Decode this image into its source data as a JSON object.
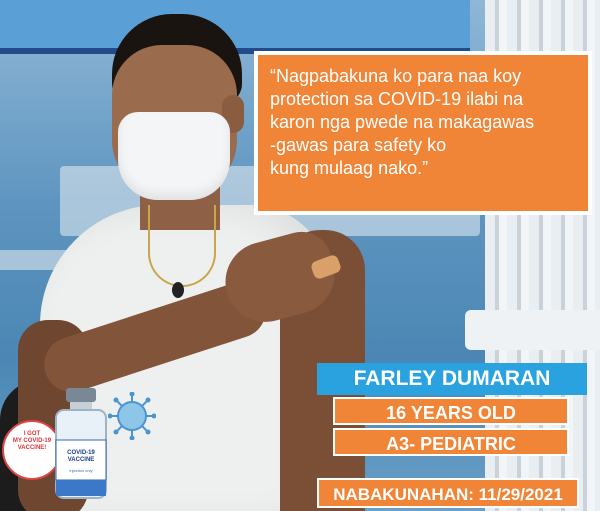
{
  "quote": "“Nagpabakuna ko para naa koy protection sa COVID-19 ilabi na karon nga pwede na makagawas -gawas para safety ko kung mulaag nako.”",
  "quote_lines": [
    "“Nagpabakuna ko para naa koy",
    "protection sa COVID-19 ilabi na",
    "karon nga pwede na makagawas",
    "-gawas para safety ko",
    "kung mulaag nako.”"
  ],
  "name": "FARLEY DUMARAN",
  "age": "16 YEARS OLD",
  "category": "A3- PEDIATRIC",
  "vaccinated_label": "NABAKUNAHAN: 11/29/2021",
  "badge": {
    "line1": "I GOT",
    "line2": "MY COVID-19",
    "line3": "VACCINE!"
  },
  "vial": {
    "title1": "COVID-19",
    "title2": "VACCINE",
    "note": "injection only"
  },
  "colors": {
    "orange": "#f08437",
    "blue": "#2aa2e0",
    "white": "#ffffff"
  }
}
